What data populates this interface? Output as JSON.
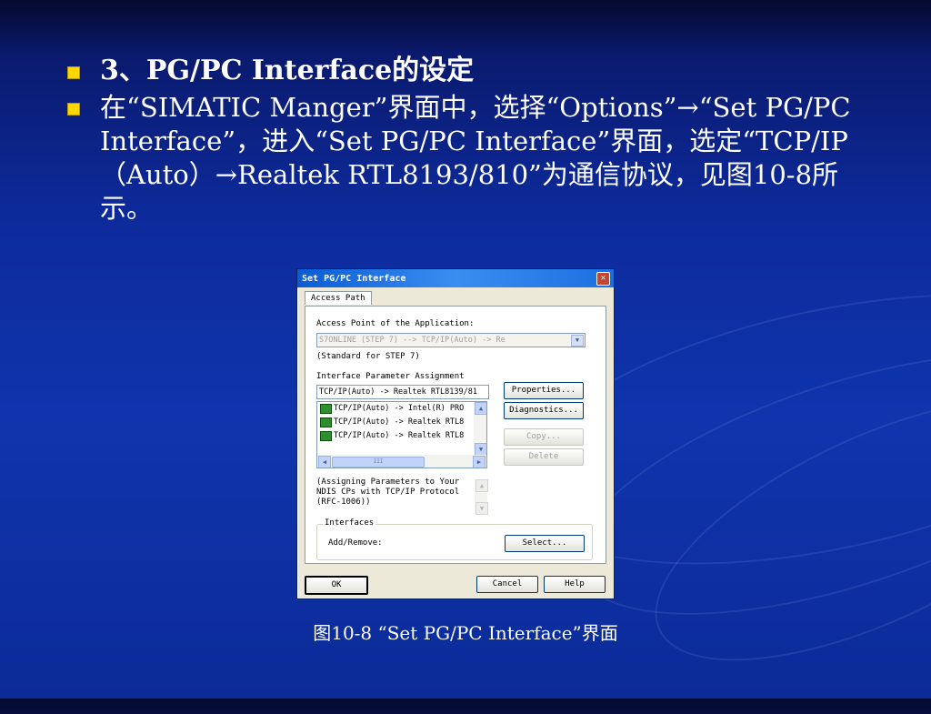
{
  "slide": {
    "bullets": [
      "3、PG/PC Interface的设定",
      "在“SIMATIC Manger”界面中，选择“Options”→“Set PG/PC Interface”，进入“Set PG/PC Interface”界面，选定“TCP/IP（Auto）→Realtek RTL8193/810”为通信协议，见图10-8所示。"
    ],
    "caption": "图10-8 “Set PG/PC Interface”界面",
    "accent_color": "#ffd700"
  },
  "dialog": {
    "title": "Set PG/PC Interface",
    "close_icon": "close-icon",
    "tab": "Access Path",
    "access_point_label": "Access Point of the Application:",
    "access_point_value": "S7ONLINE      (STEP 7)      --> TCP/IP(Auto) -> Re",
    "access_point_note": "(Standard for STEP 7)",
    "interface_param_label": "Interface Parameter Assignment",
    "interface_param_value": "TCP/IP(Auto) -> Realtek RTL8139/81",
    "interfaces_list": [
      "TCP/IP(Auto) -> Intel(R) PRO",
      "TCP/IP(Auto) -> Realtek RTL8",
      "TCP/IP(Auto) -> Realtek RTL8"
    ],
    "scroll_thumb_label": "III",
    "buttons": {
      "properties": "Properties...",
      "diagnostics": "Diagnostics...",
      "copy": "Copy...",
      "delete": "Delete",
      "select": "Select...",
      "ok": "OK",
      "cancel": "Cancel",
      "help": "Help"
    },
    "description": "(Assigning Parameters to Your\nNDIS CPs with TCP/IP Protocol\n(RFC-1006))",
    "interfaces_group": "Interfaces",
    "add_remove_label": "Add/Remove:"
  }
}
